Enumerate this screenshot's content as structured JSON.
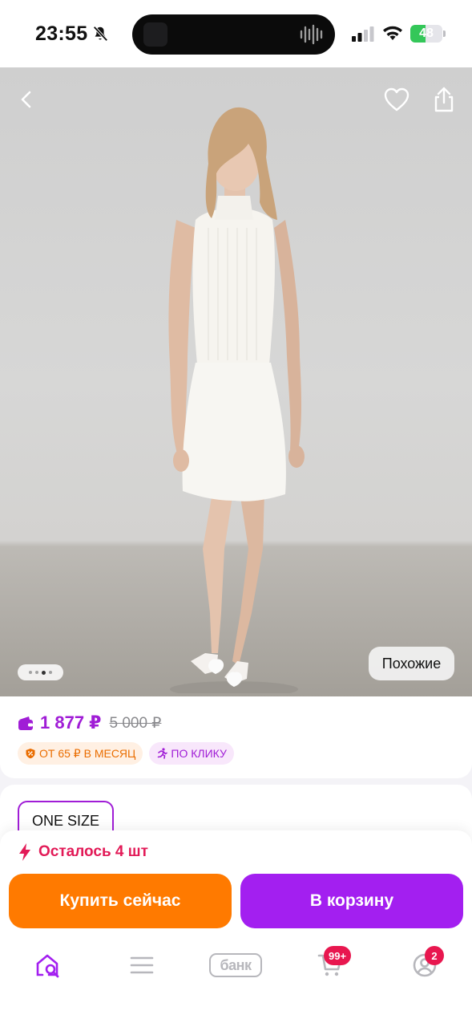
{
  "status_bar": {
    "time": "23:55",
    "battery_percent": "48",
    "battery_level": 0.48,
    "icons": [
      "bell-off-icon",
      "signal-icon",
      "wifi-icon",
      "battery-icon"
    ]
  },
  "product_image": {
    "icons": [
      "chevron-left-icon",
      "heart-icon",
      "share-icon"
    ],
    "pager": {
      "total": 4,
      "active_index": 2
    },
    "similar_label": "Похожие"
  },
  "price": {
    "current": "1 877 ₽",
    "old": "5 000 ₽",
    "badges": [
      {
        "label": "ОТ 65 ₽ В МЕСЯЦ",
        "icon": "shield-icon"
      },
      {
        "label": "ПО КЛИКУ",
        "icon": "running-man-icon"
      }
    ]
  },
  "size": {
    "selected": "ONE SIZE"
  },
  "actions": {
    "stock_text": "Осталось 4 шт",
    "buy_now_label": "Купить сейчас",
    "add_to_cart_label": "В корзину"
  },
  "tab_bar": {
    "items": [
      {
        "name": "home",
        "icon": "home-search-icon",
        "active": true
      },
      {
        "name": "catalog",
        "icon": "menu-icon"
      },
      {
        "name": "bank",
        "label": "банк"
      },
      {
        "name": "cart",
        "icon": "cart-icon",
        "badge": "99+"
      },
      {
        "name": "profile",
        "icon": "profile-icon",
        "badge": "2"
      }
    ]
  },
  "colors": {
    "accent_purple": "#a01dd6",
    "orange": "#ff7a00",
    "button_purple": "#a31ff0",
    "alert_red": "#e21a57"
  }
}
